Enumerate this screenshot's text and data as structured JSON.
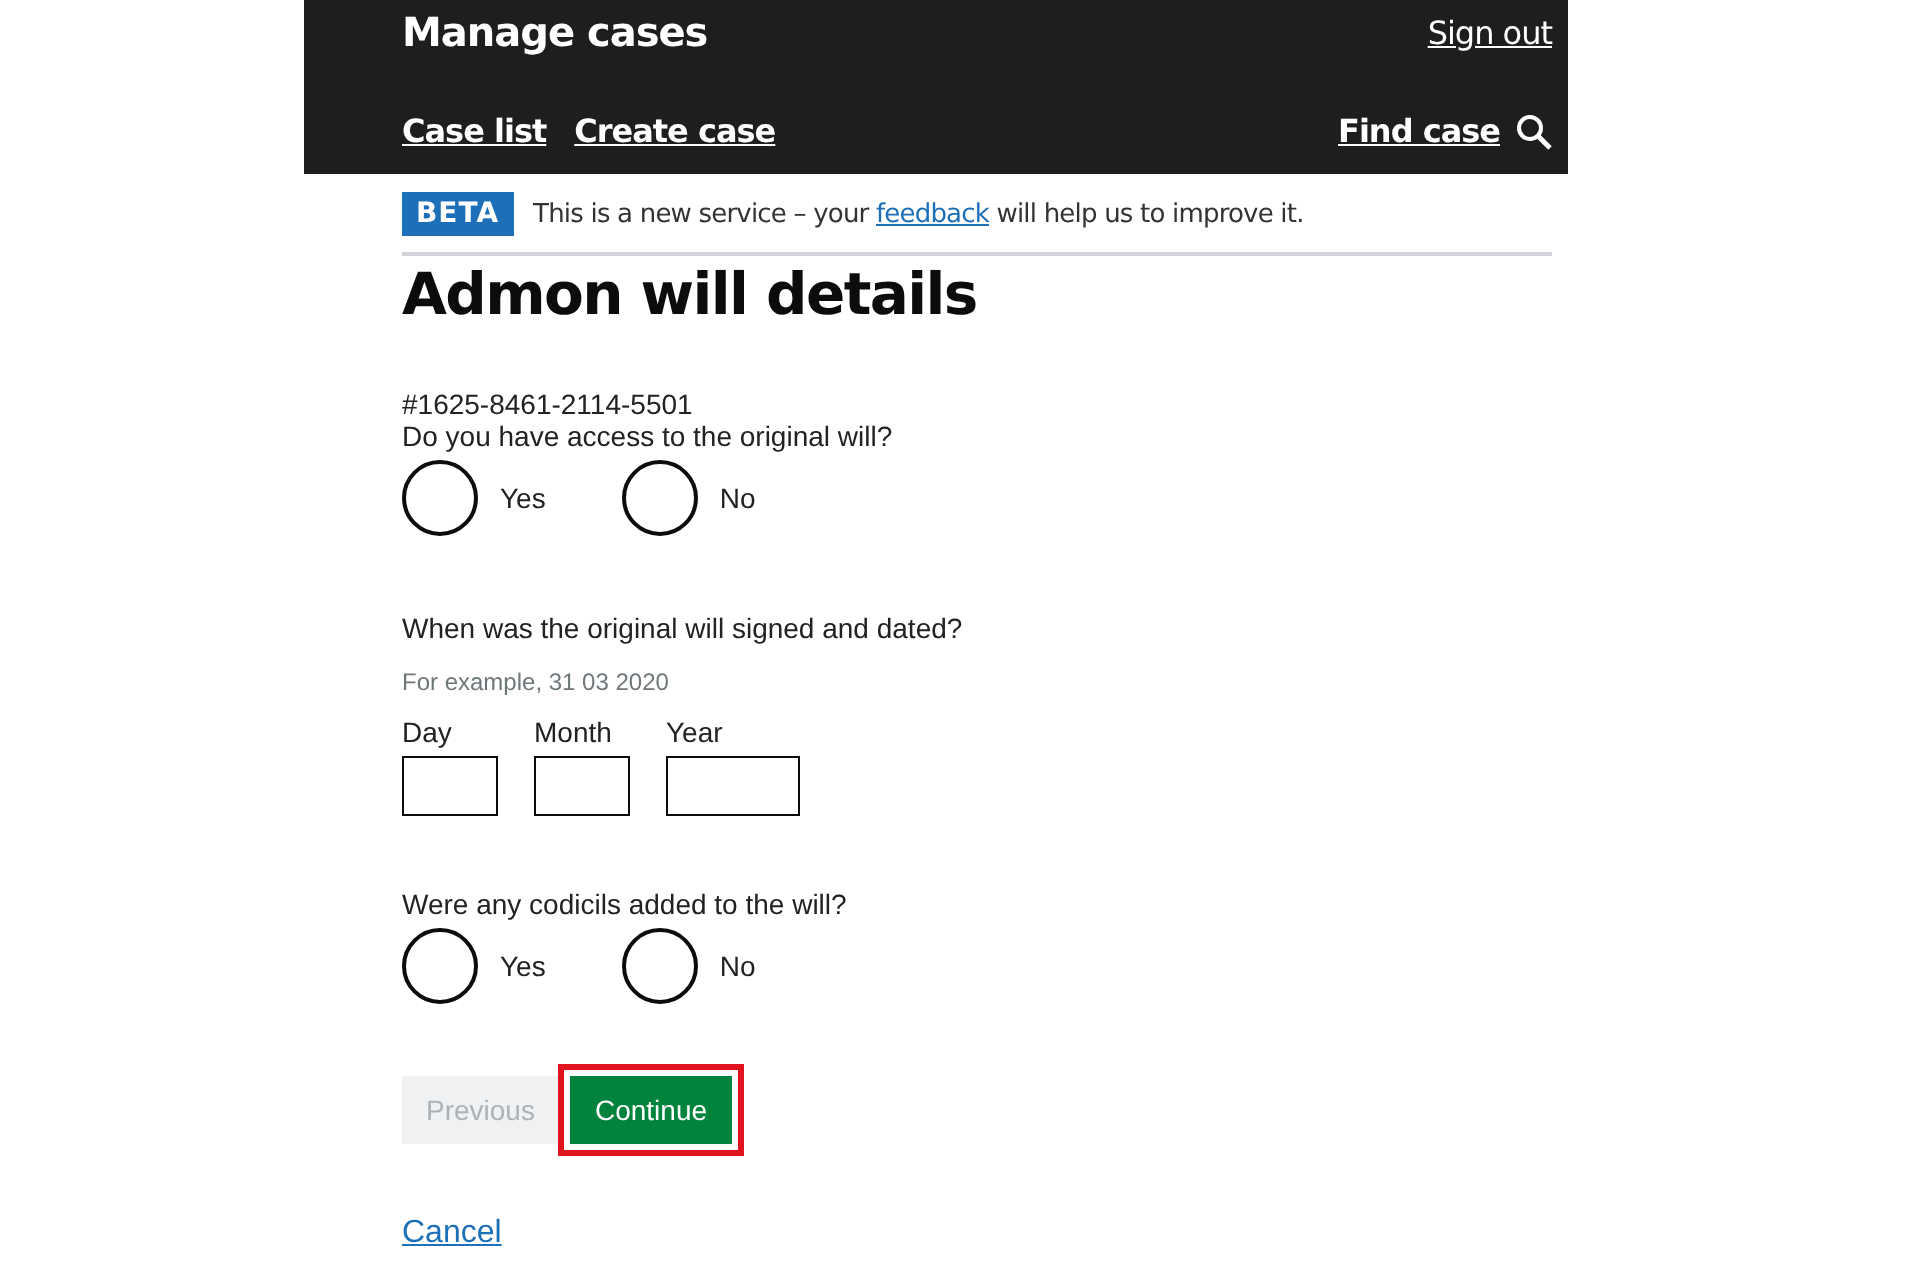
{
  "header": {
    "title": "Manage cases",
    "sign_out": "Sign out",
    "nav": [
      "Case list",
      "Create case"
    ],
    "find": "Find case"
  },
  "banner": {
    "tag": "BETA",
    "text_before": "This is a new service – your ",
    "link": "feedback",
    "text_after": " will help us to improve it."
  },
  "heading": "Admon will details",
  "reference": "#1625-8461-2114-5501",
  "questions": [
    {
      "kind": "radio",
      "label": "Do you have access to the original will?",
      "options": [
        {
          "label": "Yes",
          "selected": false
        },
        {
          "label": "No",
          "selected": false
        }
      ]
    },
    {
      "kind": "date",
      "label": "When was the original will signed and dated?",
      "hint": "For example, 31 03 2020",
      "fields": [
        {
          "label": "Day",
          "kind": "short"
        },
        {
          "label": "Month",
          "kind": "short"
        },
        {
          "label": "Year",
          "kind": "long"
        }
      ]
    },
    {
      "kind": "radio",
      "label": "Were any codicils added to the will?",
      "options": [
        {
          "label": "Yes",
          "selected": false
        },
        {
          "label": "No",
          "selected": false
        }
      ]
    }
  ],
  "buttons": [
    {
      "label": "Previous",
      "kind": "secondary",
      "disabled": true,
      "highlighted": false
    },
    {
      "label": "Continue",
      "kind": "primary",
      "disabled": false,
      "highlighted": true
    }
  ],
  "cancel": "Cancel"
}
